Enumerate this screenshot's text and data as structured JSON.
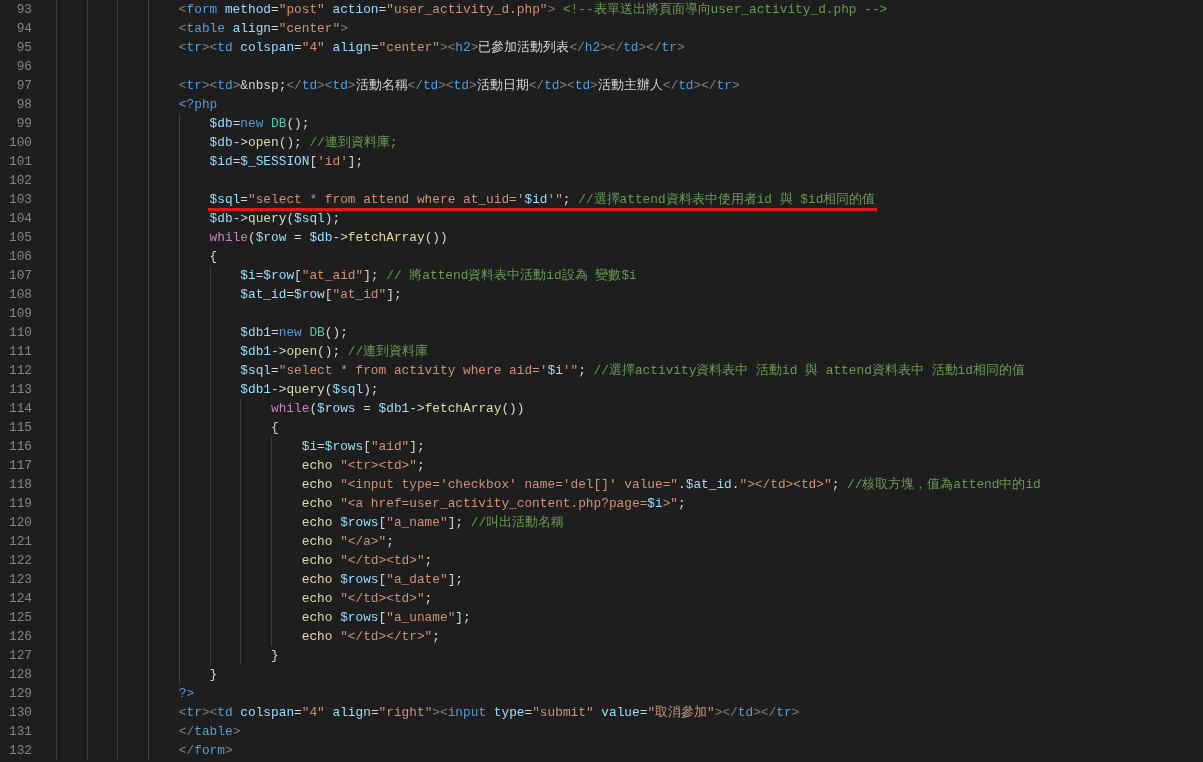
{
  "editor": {
    "lines": [
      {
        "number": "93",
        "tokens": [
          {
            "kind": "br",
            "text": "                <"
          },
          {
            "kind": "tag",
            "text": "form"
          },
          {
            "kind": "attr",
            "text": " method"
          },
          {
            "kind": "p",
            "text": "="
          },
          {
            "kind": "str",
            "text": "\"post\""
          },
          {
            "kind": "attr",
            "text": " action"
          },
          {
            "kind": "p",
            "text": "="
          },
          {
            "kind": "str",
            "text": "\"user_activity_d.php\""
          },
          {
            "kind": "br",
            "text": ">"
          },
          {
            "kind": "com",
            "text": " <!--表單送出將頁面導向user_activity_d.php -->"
          }
        ]
      },
      {
        "number": "94",
        "tokens": [
          {
            "kind": "br",
            "text": "                <"
          },
          {
            "kind": "tag",
            "text": "table"
          },
          {
            "kind": "attr",
            "text": " align"
          },
          {
            "kind": "p",
            "text": "="
          },
          {
            "kind": "str",
            "text": "\"center\""
          },
          {
            "kind": "br",
            "text": ">"
          }
        ]
      },
      {
        "number": "95",
        "tokens": [
          {
            "kind": "br",
            "text": "                <"
          },
          {
            "kind": "tag",
            "text": "tr"
          },
          {
            "kind": "br",
            "text": "><"
          },
          {
            "kind": "tag",
            "text": "td"
          },
          {
            "kind": "attr",
            "text": " colspan"
          },
          {
            "kind": "p",
            "text": "="
          },
          {
            "kind": "str",
            "text": "\"4\""
          },
          {
            "kind": "attr",
            "text": " align"
          },
          {
            "kind": "p",
            "text": "="
          },
          {
            "kind": "str",
            "text": "\"center\""
          },
          {
            "kind": "br",
            "text": "><"
          },
          {
            "kind": "tag",
            "text": "h2"
          },
          {
            "kind": "br",
            "text": ">"
          },
          {
            "kind": "p",
            "text": "已參加活動列表"
          },
          {
            "kind": "br",
            "text": "</"
          },
          {
            "kind": "tag",
            "text": "h2"
          },
          {
            "kind": "br",
            "text": "></"
          },
          {
            "kind": "tag",
            "text": "td"
          },
          {
            "kind": "br",
            "text": "></"
          },
          {
            "kind": "tag",
            "text": "tr"
          },
          {
            "kind": "br",
            "text": ">"
          }
        ]
      },
      {
        "number": "96"
      },
      {
        "number": "97",
        "tokens": [
          {
            "kind": "br",
            "text": "                <"
          },
          {
            "kind": "tag",
            "text": "tr"
          },
          {
            "kind": "br",
            "text": "><"
          },
          {
            "kind": "tag",
            "text": "td"
          },
          {
            "kind": "br",
            "text": ">"
          },
          {
            "kind": "p",
            "text": "&nbsp;"
          },
          {
            "kind": "br",
            "text": "</"
          },
          {
            "kind": "tag",
            "text": "td"
          },
          {
            "kind": "br",
            "text": "><"
          },
          {
            "kind": "tag",
            "text": "td"
          },
          {
            "kind": "br",
            "text": ">"
          },
          {
            "kind": "p",
            "text": "活動名稱"
          },
          {
            "kind": "br",
            "text": "</"
          },
          {
            "kind": "tag",
            "text": "td"
          },
          {
            "kind": "br",
            "text": "><"
          },
          {
            "kind": "tag",
            "text": "td"
          },
          {
            "kind": "br",
            "text": ">"
          },
          {
            "kind": "p",
            "text": "活動日期"
          },
          {
            "kind": "br",
            "text": "</"
          },
          {
            "kind": "tag",
            "text": "td"
          },
          {
            "kind": "br",
            "text": "><"
          },
          {
            "kind": "tag",
            "text": "td"
          },
          {
            "kind": "br",
            "text": ">"
          },
          {
            "kind": "p",
            "text": "活動主辦人"
          },
          {
            "kind": "br",
            "text": "</"
          },
          {
            "kind": "tag",
            "text": "td"
          },
          {
            "kind": "br",
            "text": "></"
          },
          {
            "kind": "tag",
            "text": "tr"
          },
          {
            "kind": "br",
            "text": ">"
          }
        ]
      },
      {
        "number": "98",
        "tokens": [
          {
            "kind": "tag",
            "text": "                <?php"
          }
        ]
      },
      {
        "number": "99",
        "tokens": [
          {
            "kind": "var",
            "text": "                    $db"
          },
          {
            "kind": "p",
            "text": "="
          },
          {
            "kind": "kw",
            "text": "new"
          },
          {
            "kind": "cls",
            "text": " DB"
          },
          {
            "kind": "p",
            "text": "();"
          }
        ]
      },
      {
        "number": "100",
        "tokens": [
          {
            "kind": "var",
            "text": "                    $db"
          },
          {
            "kind": "p",
            "text": "->"
          },
          {
            "kind": "fn",
            "text": "open"
          },
          {
            "kind": "p",
            "text": "(); "
          },
          {
            "kind": "com",
            "text": "//連到資料庫;"
          }
        ]
      },
      {
        "number": "101",
        "tokens": [
          {
            "kind": "var",
            "text": "                    $id"
          },
          {
            "kind": "p",
            "text": "="
          },
          {
            "kind": "var",
            "text": "$_SESSION"
          },
          {
            "kind": "p",
            "text": "["
          },
          {
            "kind": "str",
            "text": "'id'"
          },
          {
            "kind": "p",
            "text": "];"
          }
        ]
      },
      {
        "number": "102"
      },
      {
        "number": "103",
        "underlined": true,
        "tokens": [
          {
            "kind": "var",
            "text": "                    $sql"
          },
          {
            "kind": "p",
            "text": "="
          },
          {
            "kind": "str",
            "text": "\"select * from attend where at_uid='"
          },
          {
            "kind": "var",
            "text": "$id"
          },
          {
            "kind": "str",
            "text": "'\""
          },
          {
            "kind": "p",
            "text": "; "
          },
          {
            "kind": "com",
            "text": "//選擇attend資料表中使用者id 與 $id相同的值"
          }
        ]
      },
      {
        "number": "104",
        "tokens": [
          {
            "kind": "var",
            "text": "                    $db"
          },
          {
            "kind": "p",
            "text": "->"
          },
          {
            "kind": "fn",
            "text": "query"
          },
          {
            "kind": "p",
            "text": "("
          },
          {
            "kind": "var",
            "text": "$sql"
          },
          {
            "kind": "p",
            "text": ");"
          }
        ]
      },
      {
        "number": "105",
        "tokens": [
          {
            "kind": "ctl",
            "text": "                    while"
          },
          {
            "kind": "p",
            "text": "("
          },
          {
            "kind": "var",
            "text": "$row"
          },
          {
            "kind": "p",
            "text": " = "
          },
          {
            "kind": "var",
            "text": "$db"
          },
          {
            "kind": "p",
            "text": "->"
          },
          {
            "kind": "fn",
            "text": "fetchArray"
          },
          {
            "kind": "p",
            "text": "())"
          }
        ]
      },
      {
        "number": "106",
        "tokens": [
          {
            "kind": "p",
            "text": "                    {"
          }
        ]
      },
      {
        "number": "107",
        "tokens": [
          {
            "kind": "var",
            "text": "                        $i"
          },
          {
            "kind": "p",
            "text": "="
          },
          {
            "kind": "var",
            "text": "$row"
          },
          {
            "kind": "p",
            "text": "["
          },
          {
            "kind": "str",
            "text": "\"at_aid\""
          },
          {
            "kind": "p",
            "text": "]; "
          },
          {
            "kind": "com",
            "text": "// 將attend資料表中活動id設為 變數$i"
          }
        ]
      },
      {
        "number": "108",
        "tokens": [
          {
            "kind": "var",
            "text": "                        $at_id"
          },
          {
            "kind": "p",
            "text": "="
          },
          {
            "kind": "var",
            "text": "$row"
          },
          {
            "kind": "p",
            "text": "["
          },
          {
            "kind": "str",
            "text": "\"at_id\""
          },
          {
            "kind": "p",
            "text": "];"
          }
        ]
      },
      {
        "number": "109"
      },
      {
        "number": "110",
        "tokens": [
          {
            "kind": "var",
            "text": "                        $db1"
          },
          {
            "kind": "p",
            "text": "="
          },
          {
            "kind": "kw",
            "text": "new"
          },
          {
            "kind": "cls",
            "text": " DB"
          },
          {
            "kind": "p",
            "text": "();"
          }
        ]
      },
      {
        "number": "111",
        "tokens": [
          {
            "kind": "var",
            "text": "                        $db1"
          },
          {
            "kind": "p",
            "text": "->"
          },
          {
            "kind": "fn",
            "text": "open"
          },
          {
            "kind": "p",
            "text": "(); "
          },
          {
            "kind": "com",
            "text": "//連到資料庫"
          }
        ]
      },
      {
        "number": "112",
        "tokens": [
          {
            "kind": "var",
            "text": "                        $sql"
          },
          {
            "kind": "p",
            "text": "="
          },
          {
            "kind": "str",
            "text": "\"select * from activity where aid='"
          },
          {
            "kind": "var",
            "text": "$i"
          },
          {
            "kind": "str",
            "text": "'\""
          },
          {
            "kind": "p",
            "text": "; "
          },
          {
            "kind": "com",
            "text": "//選擇activity資料表中 活動id 與 attend資料表中 活動id相同的值"
          }
        ]
      },
      {
        "number": "113",
        "tokens": [
          {
            "kind": "var",
            "text": "                        $db1"
          },
          {
            "kind": "p",
            "text": "->"
          },
          {
            "kind": "fn",
            "text": "query"
          },
          {
            "kind": "p",
            "text": "("
          },
          {
            "kind": "var",
            "text": "$sql"
          },
          {
            "kind": "p",
            "text": ");"
          }
        ]
      },
      {
        "number": "114",
        "tokens": [
          {
            "kind": "ctl",
            "text": "                            while"
          },
          {
            "kind": "p",
            "text": "("
          },
          {
            "kind": "var",
            "text": "$rows"
          },
          {
            "kind": "p",
            "text": " = "
          },
          {
            "kind": "var",
            "text": "$db1"
          },
          {
            "kind": "p",
            "text": "->"
          },
          {
            "kind": "fn",
            "text": "fetchArray"
          },
          {
            "kind": "p",
            "text": "())"
          }
        ]
      },
      {
        "number": "115",
        "tokens": [
          {
            "kind": "p",
            "text": "                            {"
          }
        ]
      },
      {
        "number": "116",
        "tokens": [
          {
            "kind": "var",
            "text": "                                $i"
          },
          {
            "kind": "p",
            "text": "="
          },
          {
            "kind": "var",
            "text": "$rows"
          },
          {
            "kind": "p",
            "text": "["
          },
          {
            "kind": "str",
            "text": "\"aid\""
          },
          {
            "kind": "p",
            "text": "];"
          }
        ]
      },
      {
        "number": "117",
        "tokens": [
          {
            "kind": "fn",
            "text": "                                echo"
          },
          {
            "kind": "str",
            "text": " \"<tr><td>\""
          },
          {
            "kind": "p",
            "text": ";"
          }
        ]
      },
      {
        "number": "118",
        "tokens": [
          {
            "kind": "fn",
            "text": "                                echo"
          },
          {
            "kind": "str",
            "text": " \"<input type='checkbox' name='del[]' value=\""
          },
          {
            "kind": "p",
            "text": "."
          },
          {
            "kind": "var",
            "text": "$at_id"
          },
          {
            "kind": "p",
            "text": "."
          },
          {
            "kind": "str",
            "text": "\"></td><td>\""
          },
          {
            "kind": "p",
            "text": "; "
          },
          {
            "kind": "com",
            "text": "//核取方塊，值為attend中的id"
          }
        ]
      },
      {
        "number": "119",
        "tokens": [
          {
            "kind": "fn",
            "text": "                                echo"
          },
          {
            "kind": "str",
            "text": " \"<a href=user_activity_content.php?page="
          },
          {
            "kind": "var",
            "text": "$i"
          },
          {
            "kind": "str",
            "text": ">\""
          },
          {
            "kind": "p",
            "text": ";"
          }
        ]
      },
      {
        "number": "120",
        "tokens": [
          {
            "kind": "fn",
            "text": "                                echo"
          },
          {
            "kind": "var",
            "text": " $rows"
          },
          {
            "kind": "p",
            "text": "["
          },
          {
            "kind": "str",
            "text": "\"a_name\""
          },
          {
            "kind": "p",
            "text": "]; "
          },
          {
            "kind": "com",
            "text": "//叫出活動名稱"
          }
        ]
      },
      {
        "number": "121",
        "tokens": [
          {
            "kind": "fn",
            "text": "                                echo"
          },
          {
            "kind": "str",
            "text": " \"</a>\""
          },
          {
            "kind": "p",
            "text": ";"
          }
        ]
      },
      {
        "number": "122",
        "tokens": [
          {
            "kind": "fn",
            "text": "                                echo"
          },
          {
            "kind": "str",
            "text": " \"</td><td>\""
          },
          {
            "kind": "p",
            "text": ";"
          }
        ]
      },
      {
        "number": "123",
        "tokens": [
          {
            "kind": "fn",
            "text": "                                echo"
          },
          {
            "kind": "var",
            "text": " $rows"
          },
          {
            "kind": "p",
            "text": "["
          },
          {
            "kind": "str",
            "text": "\"a_date\""
          },
          {
            "kind": "p",
            "text": "];"
          }
        ]
      },
      {
        "number": "124",
        "tokens": [
          {
            "kind": "fn",
            "text": "                                echo"
          },
          {
            "kind": "str",
            "text": " \"</td><td>\""
          },
          {
            "kind": "p",
            "text": ";"
          }
        ]
      },
      {
        "number": "125",
        "tokens": [
          {
            "kind": "fn",
            "text": "                                echo"
          },
          {
            "kind": "var",
            "text": " $rows"
          },
          {
            "kind": "p",
            "text": "["
          },
          {
            "kind": "str",
            "text": "\"a_uname\""
          },
          {
            "kind": "p",
            "text": "];"
          }
        ]
      },
      {
        "number": "126",
        "tokens": [
          {
            "kind": "fn",
            "text": "                                echo"
          },
          {
            "kind": "str",
            "text": " \"</td></tr>\""
          },
          {
            "kind": "p",
            "text": ";"
          }
        ]
      },
      {
        "number": "127",
        "tokens": [
          {
            "kind": "p",
            "text": "                            }"
          }
        ]
      },
      {
        "number": "128",
        "tokens": [
          {
            "kind": "p",
            "text": "                    }"
          }
        ]
      },
      {
        "number": "129",
        "tokens": [
          {
            "kind": "tag",
            "text": "                ?>"
          }
        ]
      },
      {
        "number": "130",
        "tokens": [
          {
            "kind": "br",
            "text": "                <"
          },
          {
            "kind": "tag",
            "text": "tr"
          },
          {
            "kind": "br",
            "text": "><"
          },
          {
            "kind": "tag",
            "text": "td"
          },
          {
            "kind": "attr",
            "text": " colspan"
          },
          {
            "kind": "p",
            "text": "="
          },
          {
            "kind": "str",
            "text": "\"4\""
          },
          {
            "kind": "attr",
            "text": " align"
          },
          {
            "kind": "p",
            "text": "="
          },
          {
            "kind": "str",
            "text": "\"right\""
          },
          {
            "kind": "br",
            "text": "><"
          },
          {
            "kind": "tag",
            "text": "input"
          },
          {
            "kind": "attr",
            "text": " type"
          },
          {
            "kind": "p",
            "text": "="
          },
          {
            "kind": "str",
            "text": "\"submit\""
          },
          {
            "kind": "attr",
            "text": " value"
          },
          {
            "kind": "p",
            "text": "="
          },
          {
            "kind": "str",
            "text": "\"取消參加\""
          },
          {
            "kind": "br",
            "text": "></"
          },
          {
            "kind": "tag",
            "text": "td"
          },
          {
            "kind": "br",
            "text": "></"
          },
          {
            "kind": "tag",
            "text": "tr"
          },
          {
            "kind": "br",
            "text": ">"
          }
        ]
      },
      {
        "number": "131",
        "tokens": [
          {
            "kind": "br",
            "text": "                </"
          },
          {
            "kind": "tag",
            "text": "table"
          },
          {
            "kind": "br",
            "text": ">"
          }
        ]
      },
      {
        "number": "132",
        "tokens": [
          {
            "kind": "br",
            "text": "                </"
          },
          {
            "kind": "tag",
            "text": "form"
          },
          {
            "kind": "br",
            "text": ">"
          }
        ]
      }
    ]
  }
}
